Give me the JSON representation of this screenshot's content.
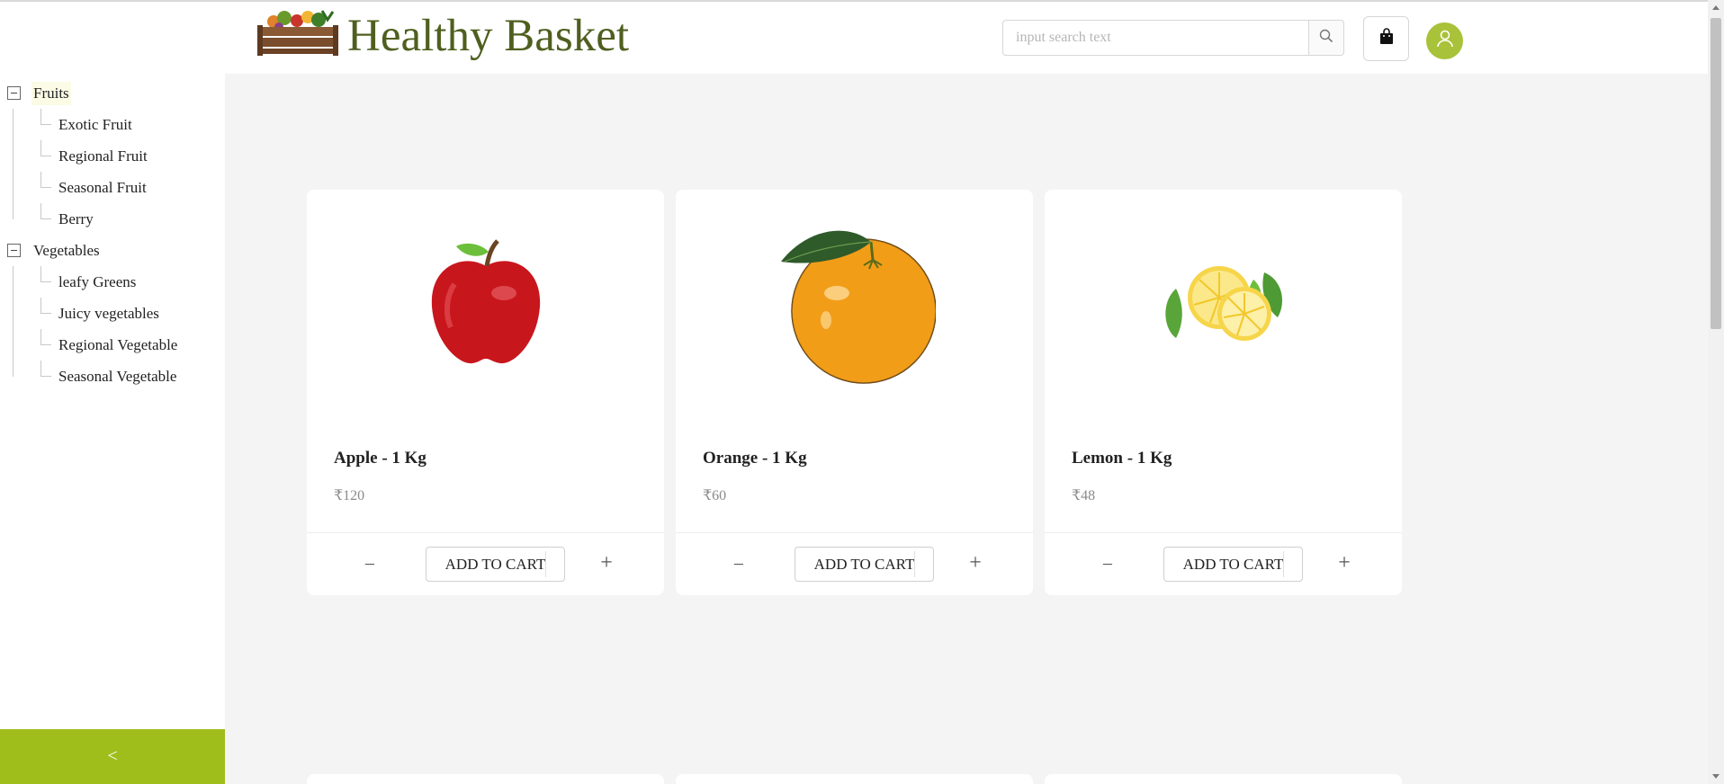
{
  "header": {
    "brand": "Healthy Basket",
    "search_placeholder": "input search text",
    "search_value": ""
  },
  "sidebar": {
    "groups": [
      {
        "label": "Fruits",
        "selected": true,
        "children": [
          "Exotic Fruit",
          "Regional Fruit",
          "Seasonal Fruit",
          "Berry"
        ]
      },
      {
        "label": "Vegetables",
        "selected": false,
        "children": [
          "leafy Greens",
          "Juicy vegetables",
          "Regional Vegetable",
          "Seasonal Vegetable"
        ]
      }
    ],
    "collapse_glyph": "<"
  },
  "products": [
    {
      "name": "Apple - 1 Kg",
      "price": "₹120",
      "image": "apple-icon",
      "button": "ADD TO CART",
      "minus": "−",
      "plus": "+"
    },
    {
      "name": "Orange - 1 Kg",
      "price": "₹60",
      "image": "orange-icon",
      "button": "ADD TO CART",
      "minus": "−",
      "plus": "+"
    },
    {
      "name": "Lemon - 1 Kg",
      "price": "₹48",
      "image": "lemon-icon",
      "button": "ADD TO CART",
      "minus": "−",
      "plus": "+"
    }
  ],
  "colors": {
    "brand_text": "#4f5f1f",
    "accent": "#9fbe1b",
    "avatar": "#a8c23a",
    "background": "#f4f4f4"
  }
}
